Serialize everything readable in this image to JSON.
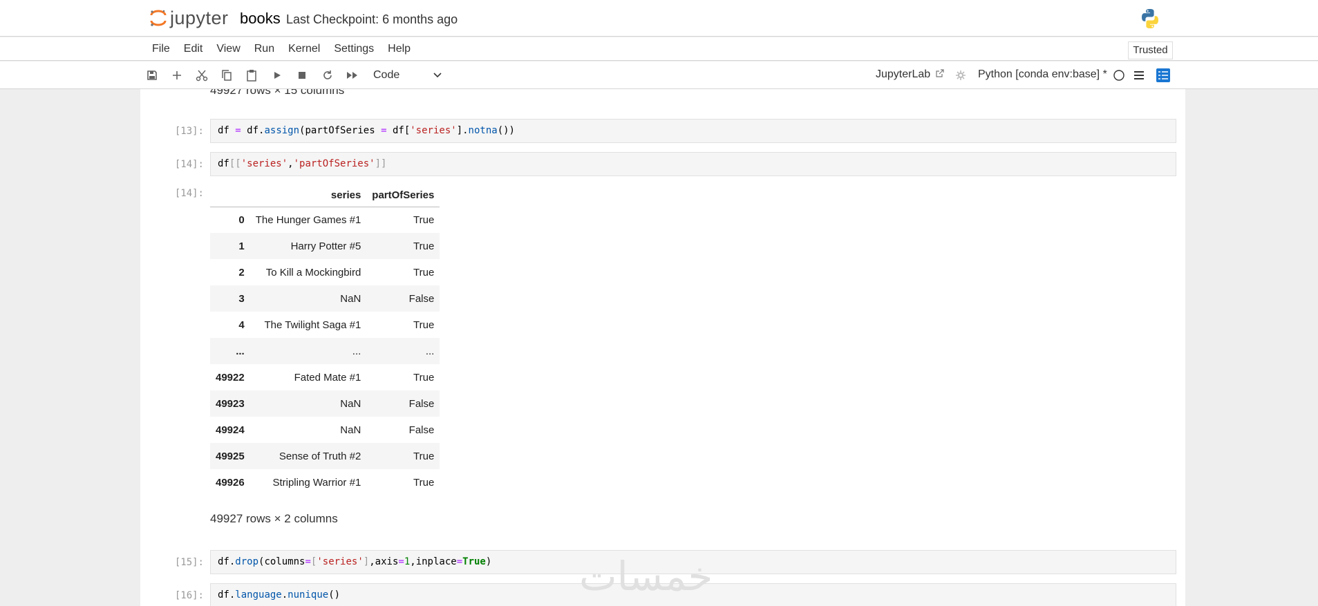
{
  "header": {
    "logo_text": "jupyter",
    "notebook_name": "books",
    "checkpoint": "Last Checkpoint: 6 months ago",
    "python_icon": "python-logo-icon"
  },
  "menu": {
    "items": [
      "File",
      "Edit",
      "View",
      "Run",
      "Kernel",
      "Settings",
      "Help"
    ],
    "trusted": "Trusted"
  },
  "toolbar": {
    "icons": [
      "save-icon",
      "add-icon",
      "cut-icon",
      "copy-icon",
      "paste-icon",
      "run-icon",
      "stop-icon",
      "restart-icon",
      "fast-forward-icon"
    ],
    "cell_type": "Code",
    "jupyterlab_link": "JupyterLab",
    "kernel": "Python [conda env:base] *"
  },
  "notebook": {
    "prev_output": "49927 rows × 15 columns",
    "cells": [
      {
        "prompt": "[13]:"
      },
      {
        "prompt": "[14]:"
      },
      {
        "out_prompt": "[14]:"
      },
      {
        "prompt": "[15]:"
      },
      {
        "prompt": "[16]:"
      }
    ],
    "dataframe": {
      "columns": [
        "series",
        "partOfSeries"
      ],
      "rows": [
        {
          "index": "0",
          "series": "The Hunger Games #1",
          "partOfSeries": "True"
        },
        {
          "index": "1",
          "series": "Harry Potter #5",
          "partOfSeries": "True"
        },
        {
          "index": "2",
          "series": "To Kill a Mockingbird",
          "partOfSeries": "True"
        },
        {
          "index": "3",
          "series": "NaN",
          "partOfSeries": "False"
        },
        {
          "index": "4",
          "series": "The Twilight Saga #1",
          "partOfSeries": "True"
        },
        {
          "index": "...",
          "series": "...",
          "partOfSeries": "..."
        },
        {
          "index": "49922",
          "series": "Fated Mate #1",
          "partOfSeries": "True"
        },
        {
          "index": "49923",
          "series": "NaN",
          "partOfSeries": "False"
        },
        {
          "index": "49924",
          "series": "NaN",
          "partOfSeries": "False"
        },
        {
          "index": "49925",
          "series": "Sense of Truth #2",
          "partOfSeries": "True"
        },
        {
          "index": "49926",
          "series": "Stripling Warrior #1",
          "partOfSeries": "True"
        }
      ],
      "shape": "49927 rows × 2 columns"
    },
    "watermark": "خمسات"
  },
  "colors": {
    "accent": "#1976d2",
    "jupyter_orange": "#f37726"
  }
}
